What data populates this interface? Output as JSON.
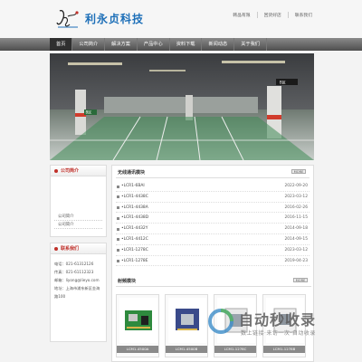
{
  "header": {
    "brand": "利永贞科技",
    "top_links": [
      "韩晶有限",
      "回货好店",
      "联系我们"
    ]
  },
  "nav": {
    "items": [
      "首页",
      "公司简介",
      "解决方案",
      "产品中心",
      "资料下载",
      "新闻动态",
      "关于我们"
    ],
    "active_index": 0
  },
  "banner": {
    "sign_left": "B区",
    "sign_right": "B区"
  },
  "sidebar": {
    "about_title": "公司简介",
    "about_items": [
      "公司简介",
      "公司简介"
    ],
    "contact_title": "联系我们",
    "contact_lines": [
      "电话：021-61312126",
      "传真：021-61112323",
      "邮箱：liyong@lieyo.com",
      "地址：上海市浦东新区金海路100"
    ]
  },
  "news": {
    "title": "无线通讯模块",
    "more_label": "MORE",
    "rows": [
      {
        "title": "•LCR1-6BAI",
        "date": "2022-09-20"
      },
      {
        "title": "•LCR1-4438C",
        "date": "2023-03-12"
      },
      {
        "title": "•LCR1-4438A",
        "date": "2016-02-26"
      },
      {
        "title": "•LCR1-4438D",
        "date": "2016-11-15"
      },
      {
        "title": "•LCR1-4432Y",
        "date": "2014-09-18"
      },
      {
        "title": "•LCR1-4412C",
        "date": "2014-09-15"
      },
      {
        "title": "•LCR1-1278C",
        "date": "2023-03-12"
      },
      {
        "title": "•LCR1-1278E",
        "date": "2019-04-23"
      }
    ]
  },
  "products": {
    "title": "射频模块",
    "more_label": "MORE",
    "items": [
      "LCM1-4500A",
      "LCM1-4500B",
      "LCM1-1278C",
      "LCM1-1278B"
    ]
  },
  "watermark": {
    "title": "自动秒收录",
    "subtitle": "数上链接·来访一次·自动收录"
  },
  "colors": {
    "brand": "#1d6fb8",
    "nav_bg": "#4e4e4e",
    "accent_red": "#c0302a"
  }
}
